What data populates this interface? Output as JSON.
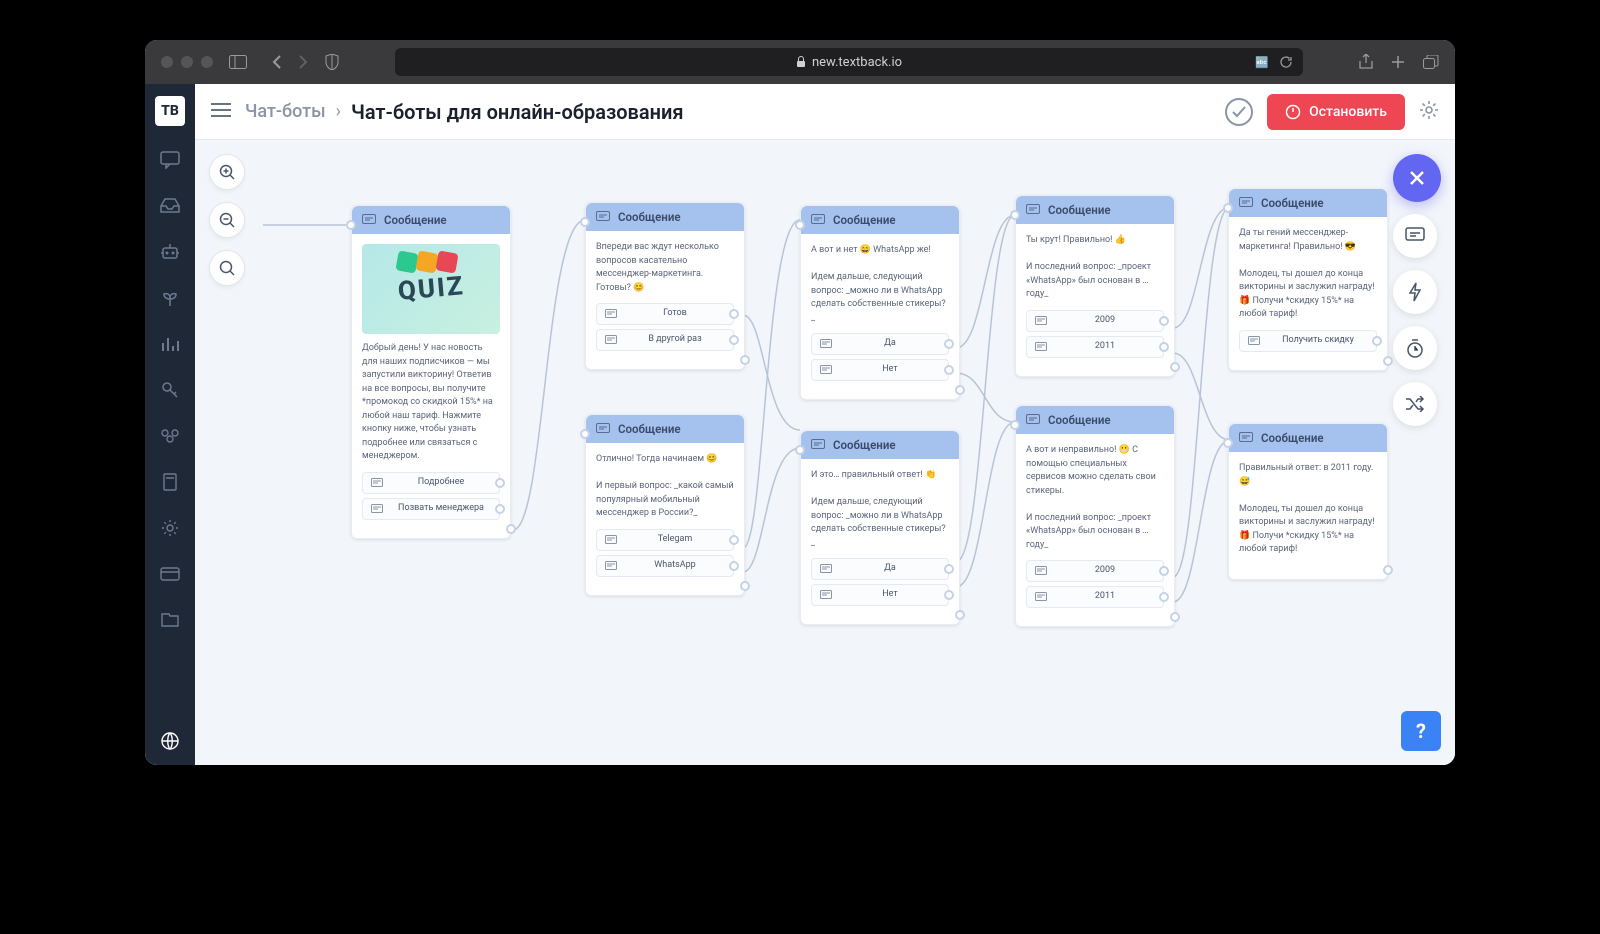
{
  "browser": {
    "url": "new.textback.io",
    "lock": "🔒"
  },
  "logo": "TB",
  "header": {
    "breadcrumb_parent": "Чат-боты",
    "title": "Чат-боты для онлайн-образования",
    "stop_label": "Остановить"
  },
  "nodes": {
    "n1": {
      "title": "Сообщение",
      "text": "Добрый день! У нас новость для наших подписчиков — мы запустили викторину! Ответив на все вопросы, вы получите *промокод со скидкой 15%* на любой наш тариф. Нажмите кнопку ниже, чтобы узнать подробнее или связаться с менеджером.",
      "buttons": [
        "Подробнее",
        "Позвать менеджера"
      ]
    },
    "n2": {
      "title": "Сообщение",
      "text": "Впереди вас ждут несколько вопросов касательно мессенджер-маркетинга. Готовы? 😊",
      "buttons": [
        "Готов",
        "В другой раз"
      ]
    },
    "n3": {
      "title": "Сообщение",
      "text": "Отлично! Тогда начинаем 😊\n\nИ первый вопрос: _какой самый популярный мобильный мессенджер в России?_",
      "buttons": [
        "Telegam",
        "WhatsApp"
      ]
    },
    "n4": {
      "title": "Сообщение",
      "text": "А вот и нет 😄 WhatsApp же!\n\nИдем дальше, следующий вопрос: _можно ли в WhatsApp сделать собственные стикеры?_",
      "buttons": [
        "Да",
        "Нет"
      ]
    },
    "n5": {
      "title": "Сообщение",
      "text": "И это… правильный ответ! 👏\n\nИдем дальше, следующий вопрос: _можно ли в WhatsApp сделать собственные стикеры?_",
      "buttons": [
        "Да",
        "Нет"
      ]
    },
    "n6": {
      "title": "Сообщение",
      "text": "Ты крут! Правильно! 👍\n\nИ последний вопрос: _проект «WhatsApp» был основан в … году_",
      "buttons": [
        "2009",
        "2011"
      ]
    },
    "n7": {
      "title": "Сообщение",
      "text": "А вот и неправильно! 😬 С помощью специальных сервисов можно сделать свои стикеры.\n\nИ последний вопрос: _проект «WhatsApp» был основан в … году_",
      "buttons": [
        "2009",
        "2011"
      ]
    },
    "n8": {
      "title": "Сообщение",
      "text": "Да ты гений мессенджер-маркетинга! Правильно! 😎\n\nМолодец, ты дошел до конца викторины и заслужил награду! 🎁 Получи *скидку 15%* на любой тариф!",
      "buttons": [
        "Получить скидку"
      ]
    },
    "n9": {
      "title": "Сообщение",
      "text": "Правильный ответ: в 2011 году. 😅\n\nМолодец, ты дошел до конца викторины и заслужил награду! 🎁 Получи *скидку 15%* на любой тариф!",
      "buttons": []
    }
  },
  "quiz_image_text": "QUIZ",
  "help": "?"
}
